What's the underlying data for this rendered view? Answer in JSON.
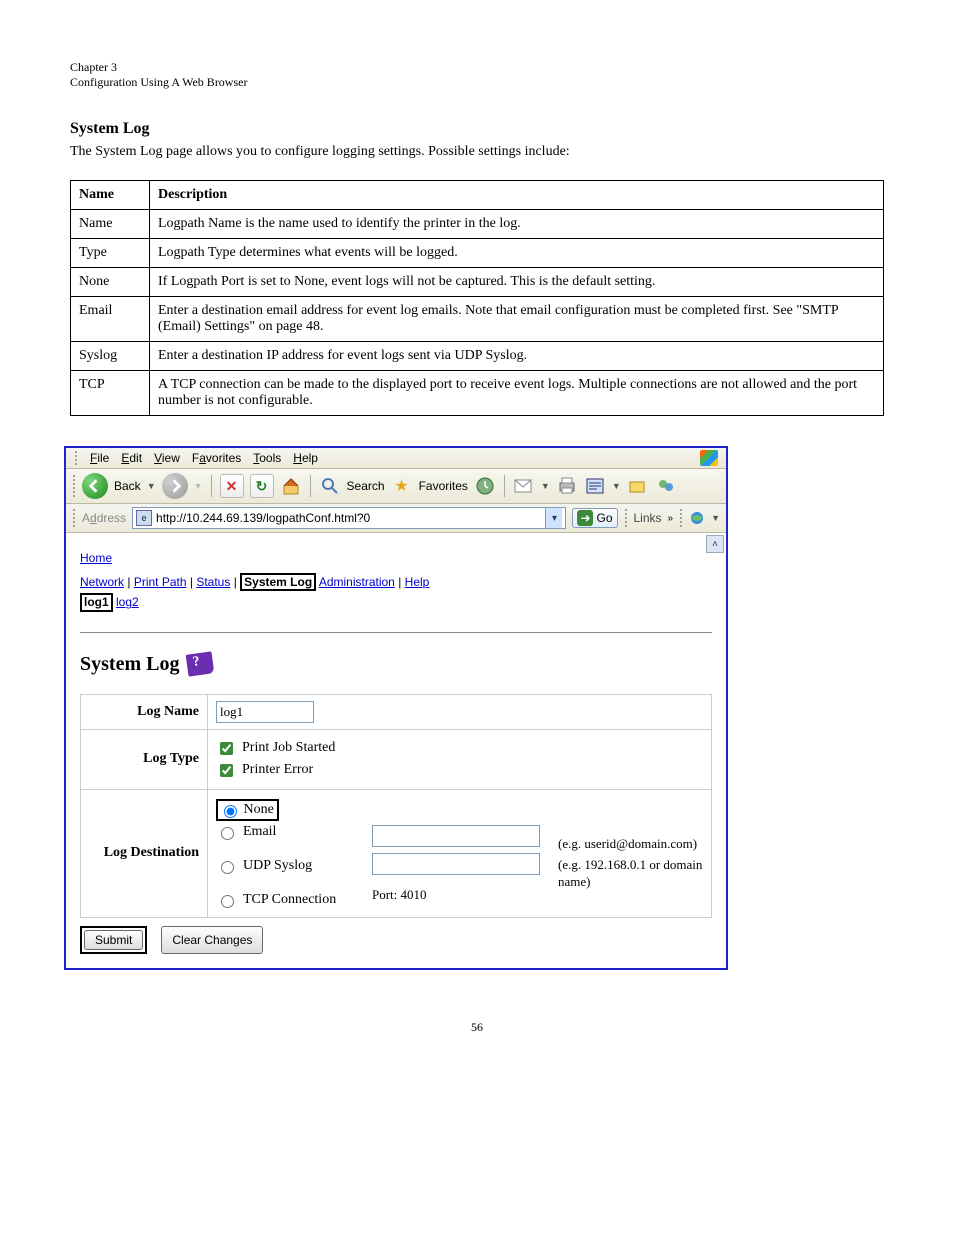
{
  "page": {
    "chapter": "Chapter 3",
    "chapter_title": "Configuration Using A Web Browser",
    "page_number": "56",
    "section_heading": "System Log",
    "section_intro": "The System Log page allows you to configure logging settings. Possible settings include:"
  },
  "doc_table": [
    {
      "name": "Name",
      "desc": "Logpath Name is the name used to identify the printer in the log."
    },
    {
      "name": "Type",
      "desc": "Logpath Type determines what events will be logged."
    },
    {
      "name": "None",
      "desc": "If Logpath Port is set to None, event logs will not be captured. This is the default setting."
    },
    {
      "name": "Email",
      "desc": "Enter a destination email address for event log emails. Note that email configuration must be completed first. See \"SMTP (Email) Settings\" on page 48."
    },
    {
      "name": "Syslog",
      "desc": "Enter a destination IP address for event logs sent via UDP Syslog."
    },
    {
      "name": "TCP",
      "desc": "A TCP connection can be made to the displayed port to receive event logs. Multiple connections are not allowed and the port number is not configurable."
    }
  ],
  "menus": {
    "file": "File",
    "edit": "Edit",
    "view": "View",
    "favorites": "Favorites",
    "tools": "Tools",
    "help": "Help"
  },
  "toolbar": {
    "back": "Back",
    "search": "Search",
    "favorites": "Favorites"
  },
  "address": {
    "label": "Address",
    "url": "http://10.244.69.139/logpathConf.html?0",
    "go": "Go",
    "links": "Links"
  },
  "nav": {
    "home": "Home",
    "network": "Network",
    "printpath": "Print Path",
    "status": "Status",
    "systemlog": "System Log",
    "admin": "Administration",
    "help": "Help",
    "log1": "log1",
    "log2": "log2"
  },
  "form": {
    "heading": "System Log",
    "logname_label": "Log Name",
    "logname_value": "log1",
    "logtype_label": "Log Type",
    "logtype_opt1": "Print Job Started",
    "logtype_opt2": "Printer Error",
    "logdest_label": "Log Destination",
    "dest_none": "None",
    "dest_email": "Email",
    "dest_udp": "UDP Syslog",
    "dest_tcp": "TCP Connection",
    "email_hint": "(e.g. userid@domain.com)",
    "udp_hint": "(e.g. 192.168.0.1 or domain name)",
    "tcp_port": "Port: 4010",
    "submit": "Submit",
    "clear": "Clear Changes"
  }
}
